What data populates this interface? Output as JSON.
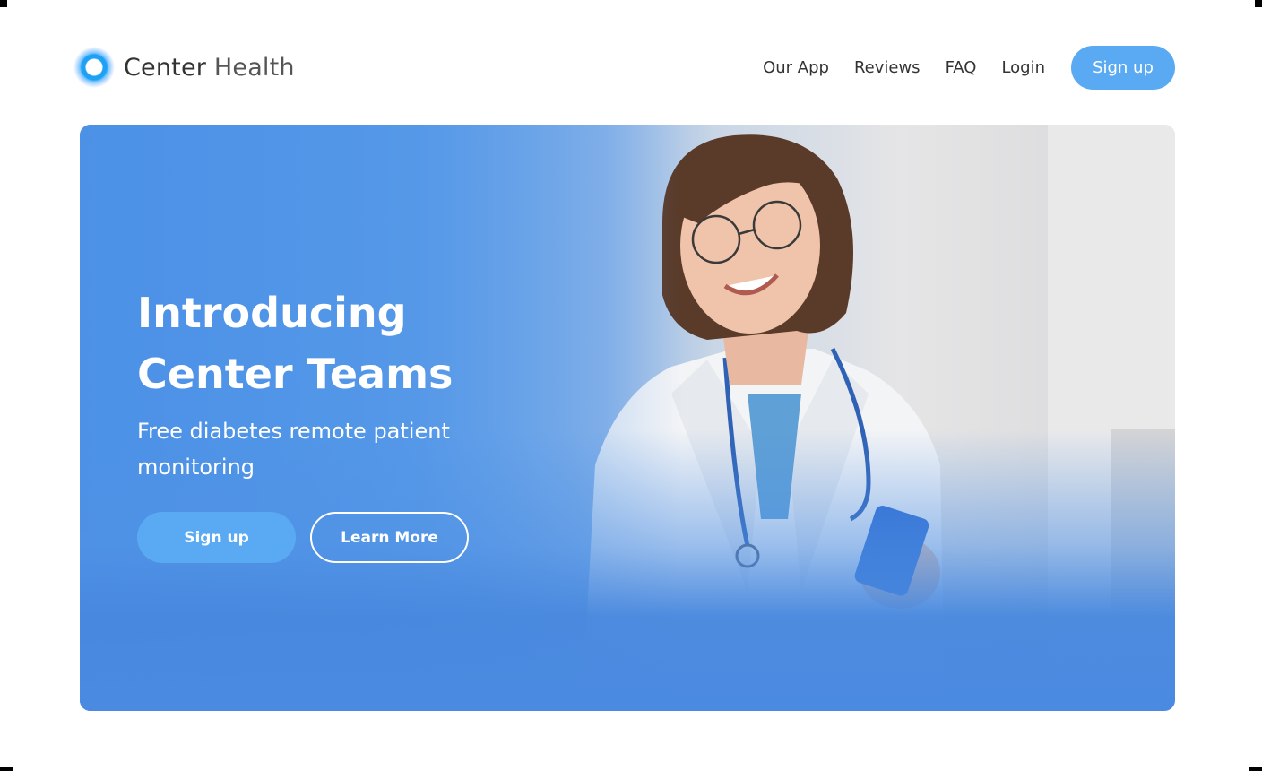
{
  "brand": {
    "name_primary": "Center",
    "name_secondary": "Health"
  },
  "nav": {
    "items": [
      {
        "label": "Our App"
      },
      {
        "label": "Reviews"
      },
      {
        "label": "FAQ"
      },
      {
        "label": "Login"
      }
    ],
    "cta_label": "Sign up"
  },
  "hero": {
    "title_line1": "Introducing",
    "title_line2": "Center Teams",
    "subtitle": "Free diabetes remote patient monitoring",
    "primary_button": "Sign up",
    "secondary_button": "Learn More"
  },
  "colors": {
    "accent": "#5aaaf3",
    "hero_blue": "#4a8ae0",
    "text_dark": "#333333"
  }
}
